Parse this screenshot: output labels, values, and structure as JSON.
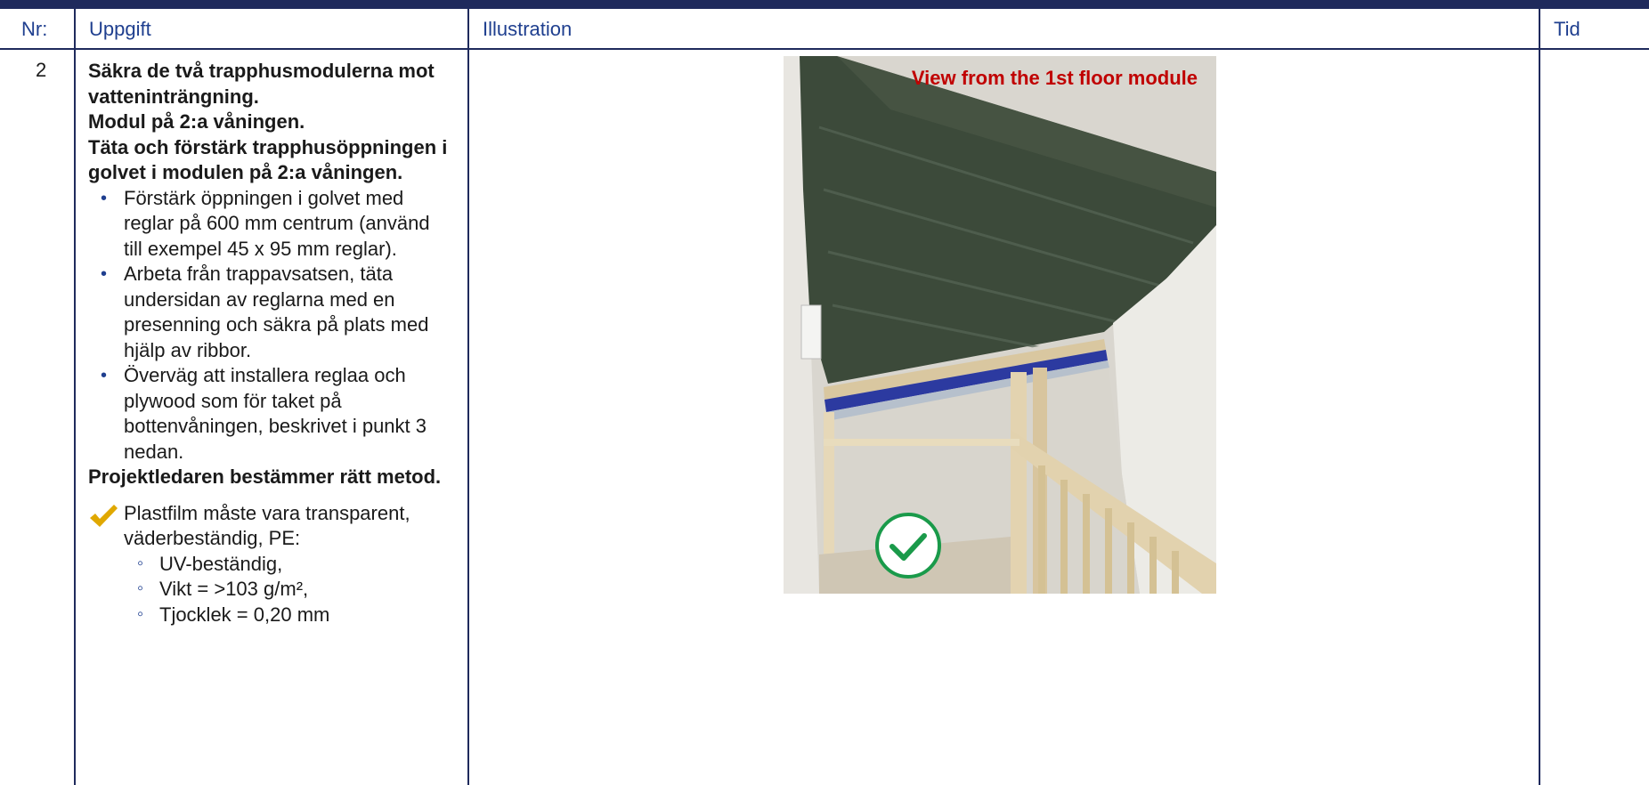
{
  "header": {
    "nr": "Nr:",
    "task": "Uppgift",
    "illustration": "Illustration",
    "time": "Tid"
  },
  "row": {
    "nr": "2",
    "intro": [
      "Säkra de två trapphusmodulerna mot vatteninträngning.",
      "Modul på 2:a våningen.",
      "Täta och förstärk trapphusöppningen i golvet i modulen på 2:a våningen."
    ],
    "bullets": [
      "Förstärk öppningen i golvet med reglar på 600 mm centrum (använd till exempel 45 x 95 mm reglar).",
      "Arbeta från trappavsatsen, täta undersidan av reglarna med en presenning och säkra på plats med hjälp av ribbor.",
      "Överväg att installera reglaa och plywood som för taket på bottenvåningen, beskrivet i punkt 3 nedan."
    ],
    "decision": "Projektledaren bestämmer rätt metod.",
    "requirement": "Plastfilm måste vara transparent, väderbeständig, PE:",
    "specs": [
      "UV-beständig,",
      "Vikt = >103 g/m²,",
      "Tjocklek = 0,20 mm"
    ],
    "time": ""
  },
  "illustration": {
    "label": "View from the 1st floor module",
    "label_color": "#c00000",
    "badge_icon": "check-circle-icon",
    "badge_color": "#1a9a4a"
  },
  "colors": {
    "header_text": "#1f3f8f",
    "border": "#1f2a5c",
    "check_mark": "#e0a800"
  }
}
